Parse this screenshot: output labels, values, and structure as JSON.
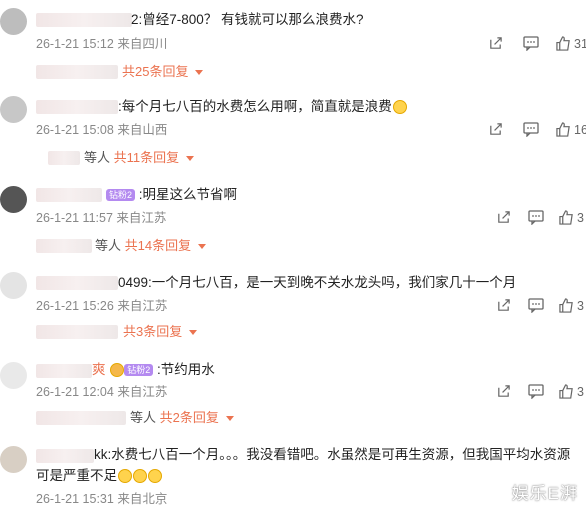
{
  "comments": [
    {
      "text": "2:曾经7-800？ 有钱就可以那么浪费水?",
      "date": "26-1-21 15:12",
      "loc": "来自四川",
      "likes": "31",
      "reply_count": "共25条回复"
    },
    {
      "text": ":每个月七八百的水费怎么用啊，简直就是浪费",
      "date": "26-1-21 15:08",
      "loc": "来自山西",
      "likes": "16",
      "reply_pre": "等人",
      "reply_count": "共11条回复"
    },
    {
      "text": ":明星这么节省啊",
      "badge": "钻粉2",
      "date": "26-1-21 11:57",
      "loc": "来自江苏",
      "likes": "3",
      "reply_pre": "等人",
      "reply_count": "共14条回复"
    },
    {
      "text": "0499:一个月七八百，是一天到晚不关水龙头吗，我们家几十一个月",
      "date": "26-1-21 15:26",
      "loc": "来自江苏",
      "likes": "3",
      "reply_count": "共3条回复"
    },
    {
      "text": ":节约用水",
      "name_tail": "爽",
      "badge": "钻粉2",
      "date": "26-1-21 12:04",
      "loc": "来自江苏",
      "likes": "3",
      "reply_pre": "等人",
      "reply_count": "共2条回复"
    },
    {
      "text": "kk:水费七八百一个月。。。我没看错吧。水虽然是可再生资源，但我国平均水资源",
      "text2": "可是严重不足",
      "date": "26-1-21 15:31",
      "loc": "来自北京"
    }
  ],
  "watermark": "娱乐E湃",
  "icons": [
    "share-icon",
    "comment-icon",
    "like-icon",
    "chevron-down-icon"
  ]
}
